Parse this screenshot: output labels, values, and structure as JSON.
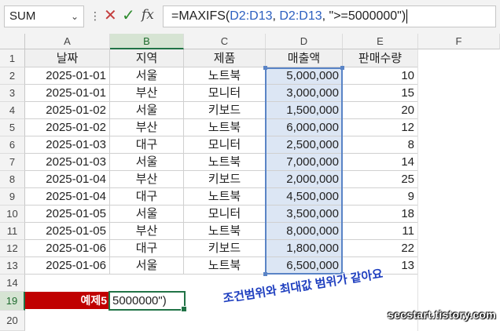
{
  "formula_bar": {
    "name_box": "SUM",
    "formula_prefix": "=MAXIFS(",
    "ref1": "D2:D13",
    "sep1": ", ",
    "ref2": "D2:D13",
    "formula_suffix": ", \">=5000000\")"
  },
  "columns": [
    "A",
    "B",
    "C",
    "D",
    "E",
    "F"
  ],
  "rows": [
    "1",
    "2",
    "3",
    "4",
    "5",
    "6",
    "7",
    "8",
    "9",
    "10",
    "11",
    "12",
    "13",
    "14",
    "19",
    "20"
  ],
  "table": {
    "headers": [
      "날짜",
      "지역",
      "제품",
      "매출액",
      "판매수량"
    ],
    "rows": [
      [
        "2025-01-01",
        "서울",
        "노트북",
        "5,000,000",
        "10"
      ],
      [
        "2025-01-01",
        "부산",
        "모니터",
        "3,000,000",
        "15"
      ],
      [
        "2025-01-02",
        "서울",
        "키보드",
        "1,500,000",
        "20"
      ],
      [
        "2025-01-02",
        "부산",
        "노트북",
        "6,000,000",
        "12"
      ],
      [
        "2025-01-03",
        "대구",
        "모니터",
        "2,500,000",
        "8"
      ],
      [
        "2025-01-03",
        "서울",
        "노트북",
        "7,000,000",
        "14"
      ],
      [
        "2025-01-04",
        "부산",
        "키보드",
        "2,000,000",
        "25"
      ],
      [
        "2025-01-04",
        "대구",
        "노트북",
        "4,500,000",
        "9"
      ],
      [
        "2025-01-05",
        "서울",
        "모니터",
        "3,500,000",
        "18"
      ],
      [
        "2025-01-05",
        "부산",
        "노트북",
        "8,000,000",
        "11"
      ],
      [
        "2025-01-06",
        "대구",
        "키보드",
        "1,800,000",
        "22"
      ],
      [
        "2025-01-06",
        "서울",
        "노트북",
        "6,500,000",
        "13"
      ]
    ]
  },
  "example": {
    "label": "예제5",
    "active_cell_text": "5000000\")"
  },
  "annotation": "조건범위와 최대값 범위가 같아요",
  "watermark": "secstart.tistory.com",
  "colors": {
    "accent_green": "#217346",
    "label_red": "#c00000",
    "selection_blue": "#5a84c6",
    "sales_fill": "#dce6f4"
  }
}
